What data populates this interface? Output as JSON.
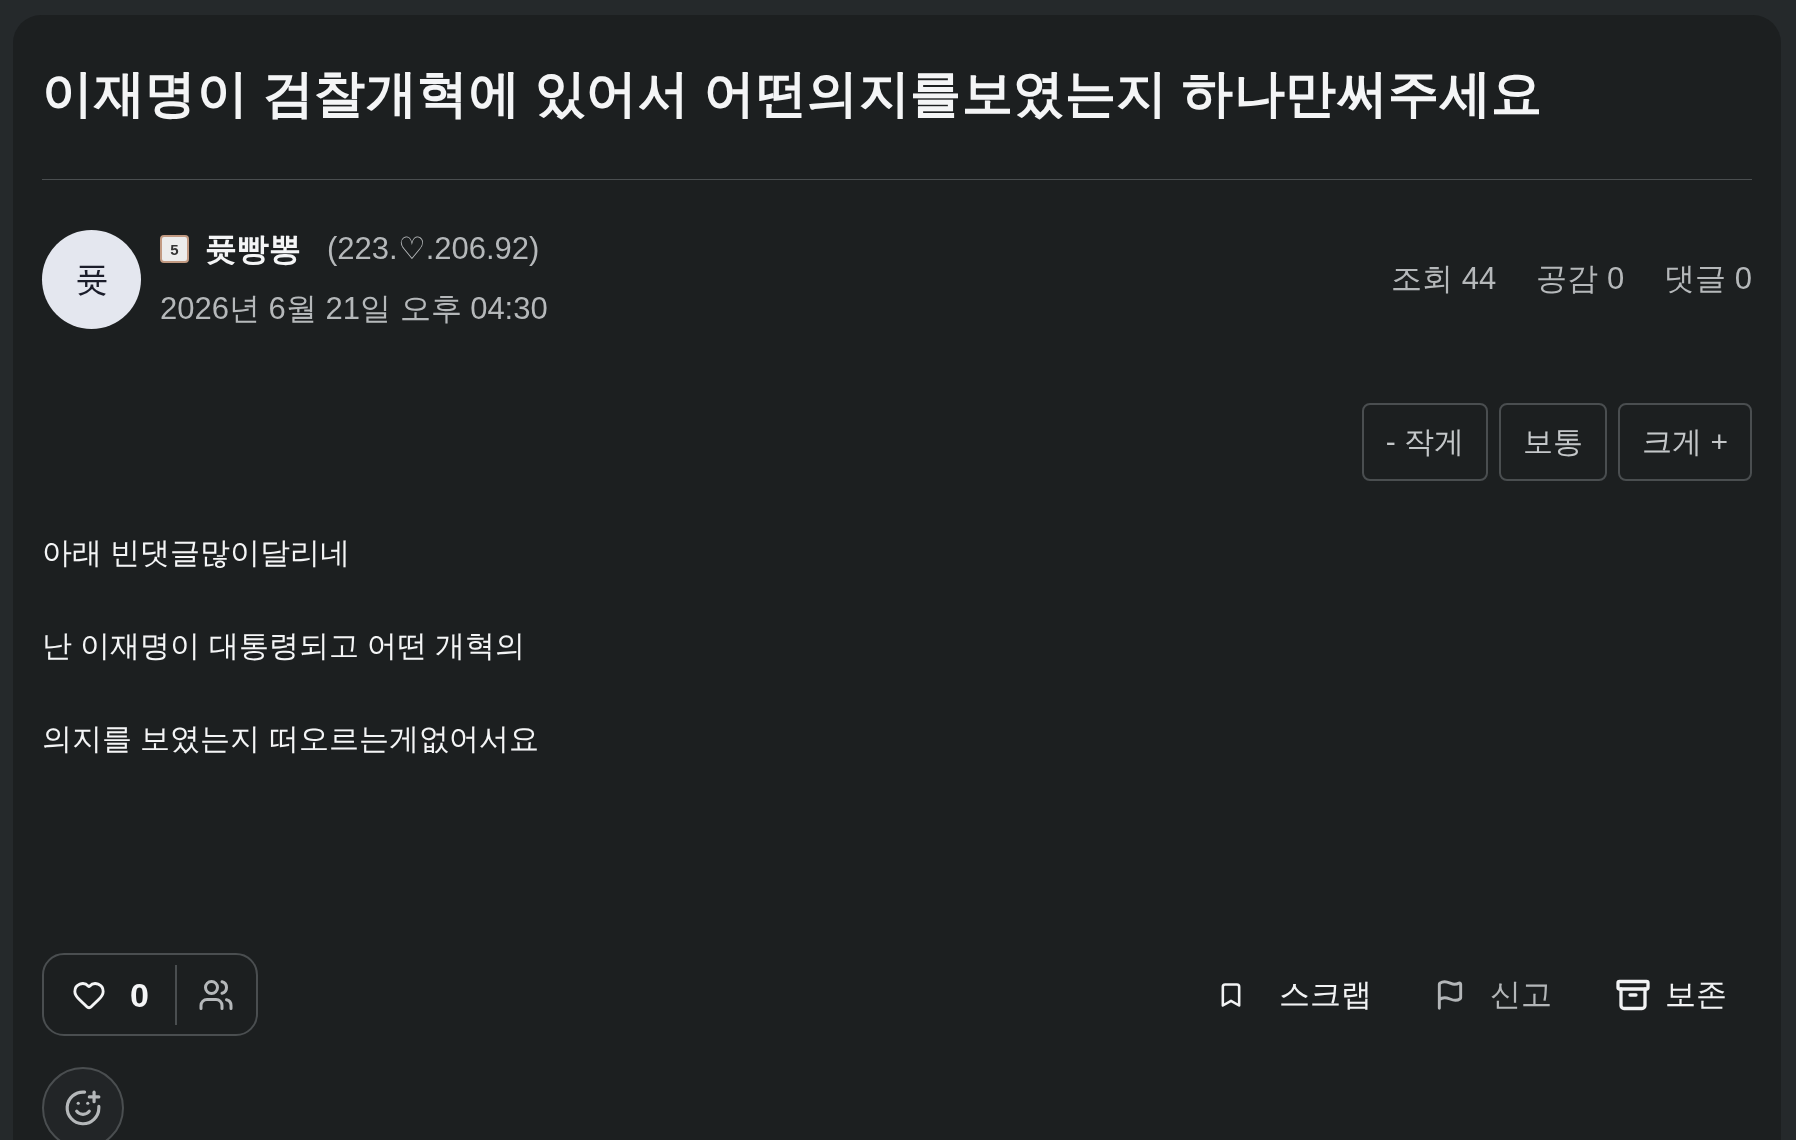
{
  "post": {
    "title": "이재명이 검찰개혁에 있어서 어떤의지를보였는지 하나만써주세요",
    "author": {
      "avatar_initial": "퓻",
      "level": "5",
      "name": "퓻빵뽕",
      "ip": "(223.♡.206.92)",
      "date": "2026년 6월 21일 오후 04:30"
    },
    "stats": [
      "조회 44",
      "공감 0",
      "댓글 0"
    ],
    "text_size_buttons": [
      "- 작게",
      "보통",
      "크게 +"
    ],
    "body": [
      "아래 빈댓글많이달리네",
      "난 이재명이 대통령되고 어떤 개혁의",
      "의지를 보였는지 떠오르는게없어서요"
    ],
    "like": {
      "count": "0"
    },
    "actions": [
      {
        "kind": "scrap",
        "label": "스크랩"
      },
      {
        "kind": "report",
        "label": "신고"
      },
      {
        "kind": "archive",
        "label": "보존"
      }
    ]
  }
}
